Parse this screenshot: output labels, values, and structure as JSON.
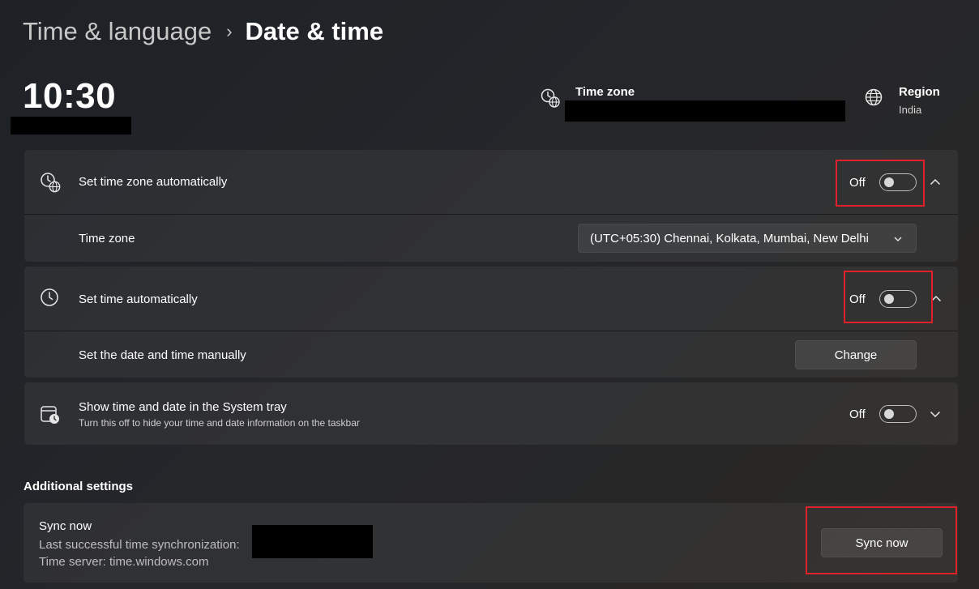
{
  "breadcrumb": {
    "parent": "Time & language",
    "separator": "›",
    "current": "Date & time"
  },
  "header": {
    "clock": "10:30",
    "time_zone_label": "Time zone",
    "region_label": "Region",
    "region_value": "India"
  },
  "settings": {
    "tz_auto": {
      "label": "Set time zone automatically",
      "state": "Off"
    },
    "time_zone": {
      "label": "Time zone",
      "value": "(UTC+05:30) Chennai, Kolkata, Mumbai, New Delhi"
    },
    "time_auto": {
      "label": "Set time automatically",
      "state": "Off"
    },
    "manual": {
      "label": "Set the date and time manually",
      "button": "Change"
    },
    "tray": {
      "label": "Show time and date in the System tray",
      "description": "Turn this off to hide your time and date information on the taskbar",
      "state": "Off"
    }
  },
  "additional": {
    "title": "Additional settings",
    "sync": {
      "title": "Sync now",
      "last_sync_label": "Last successful time synchronization:",
      "server": "Time server: time.windows.com",
      "button": "Sync now"
    }
  },
  "icons": {
    "globe_clock": "globe-clock-icon",
    "globe": "globe-icon",
    "clock": "clock-icon",
    "tray": "calendar-clock-icon"
  },
  "colors": {
    "highlight": "#e0202a",
    "background": "#212429"
  }
}
